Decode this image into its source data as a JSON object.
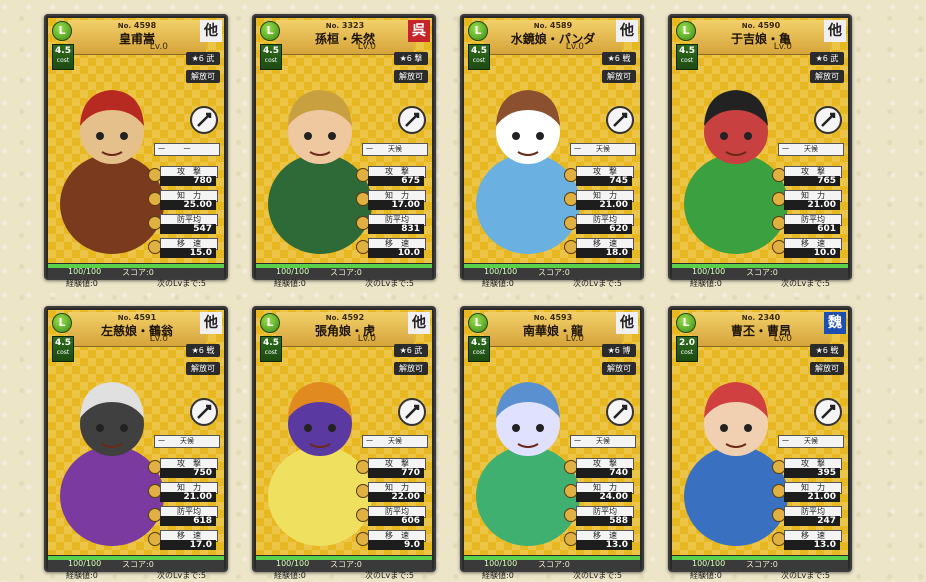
{
  "cards": [
    {
      "no": "4598",
      "name": "皇甫嵩",
      "lv": "Lv.0",
      "cost": "4.5",
      "faction": "他",
      "faction_color": "white",
      "rarity": "★6 武",
      "release": "解放可",
      "weapon": "sword-icon",
      "skill": "一",
      "stats": [
        {
          "label": "攻　撃",
          "value": "780"
        },
        {
          "label": "知　力",
          "value": "25.00"
        },
        {
          "label": "防平均",
          "value": "547"
        },
        {
          "label": "移　速",
          "value": "15.0"
        }
      ],
      "hp": "100/100",
      "hp_fraction": 1.0,
      "score": "スコア:0",
      "exp": "経験値:0",
      "next": "次のLvまで:5",
      "palette": [
        "#7a3a1e",
        "#b62a22",
        "#e6c08a"
      ]
    },
    {
      "no": "3323",
      "name": "孫桓・朱然",
      "lv": "Lv.0",
      "cost": "4.5",
      "faction": "呉",
      "faction_color": "red",
      "rarity": "★6 撃",
      "release": "解放可",
      "weapon": "axe-icon",
      "skill": "天候",
      "stats": [
        {
          "label": "攻　撃",
          "value": "675"
        },
        {
          "label": "知　力",
          "value": "17.00"
        },
        {
          "label": "防平均",
          "value": "831"
        },
        {
          "label": "移　速",
          "value": "10.0"
        }
      ],
      "hp": "100/100",
      "hp_fraction": 1.0,
      "score": "スコア:0",
      "exp": "経験値:0",
      "next": "次のLvまで:5",
      "palette": [
        "#2e6a38",
        "#c8a040",
        "#f0c8a0"
      ]
    },
    {
      "no": "4589",
      "name": "水鏡娘・パンダ",
      "lv": "Lv.0",
      "cost": "4.5",
      "faction": "他",
      "faction_color": "white",
      "rarity": "★6 戦",
      "release": "解放可",
      "weapon": "sword-icon",
      "skill": "天候",
      "stats": [
        {
          "label": "攻　撃",
          "value": "745"
        },
        {
          "label": "知　力",
          "value": "21.00"
        },
        {
          "label": "防平均",
          "value": "620"
        },
        {
          "label": "移　速",
          "value": "18.0"
        }
      ],
      "hp": "100/100",
      "hp_fraction": 1.0,
      "score": "スコア:0",
      "exp": "経験値:0",
      "next": "次のLvまで:5",
      "palette": [
        "#6ab0e0",
        "#8a5030",
        "#ffffff"
      ]
    },
    {
      "no": "4590",
      "name": "于吉娘・亀",
      "lv": "Lv.0",
      "cost": "4.5",
      "faction": "他",
      "faction_color": "white",
      "rarity": "★6 武",
      "release": "解放可",
      "weapon": "axe-icon",
      "skill": "天候",
      "stats": [
        {
          "label": "攻　撃",
          "value": "765"
        },
        {
          "label": "知　力",
          "value": "21.00"
        },
        {
          "label": "防平均",
          "value": "601"
        },
        {
          "label": "移　速",
          "value": "10.0"
        }
      ],
      "hp": "100/100",
      "hp_fraction": 1.0,
      "score": "スコア:0",
      "exp": "経験値:0",
      "next": "次のLvまで:5",
      "palette": [
        "#3aa040",
        "#222222",
        "#c84040"
      ]
    },
    {
      "no": "4591",
      "name": "左慈娘・鶴翁",
      "lv": "Lv.0",
      "cost": "4.5",
      "faction": "他",
      "faction_color": "white",
      "rarity": "★6 戦",
      "release": "解放可",
      "weapon": "sword-icon",
      "skill": "天候",
      "stats": [
        {
          "label": "攻　撃",
          "value": "750"
        },
        {
          "label": "知　力",
          "value": "21.00"
        },
        {
          "label": "防平均",
          "value": "618"
        },
        {
          "label": "移　速",
          "value": "17.0"
        }
      ],
      "hp": "100/100",
      "hp_fraction": 1.0,
      "score": "スコア:0",
      "exp": "経験値:0",
      "next": "次のLvまで:5",
      "palette": [
        "#7a3aa0",
        "#e0e0e0",
        "#404040"
      ]
    },
    {
      "no": "4592",
      "name": "張角娘・虎",
      "lv": "Lv.0",
      "cost": "4.5",
      "faction": "他",
      "faction_color": "white",
      "rarity": "★6 武",
      "release": "解放可",
      "weapon": "axe-icon",
      "skill": "天候",
      "stats": [
        {
          "label": "攻　撃",
          "value": "770"
        },
        {
          "label": "知　力",
          "value": "22.00"
        },
        {
          "label": "防平均",
          "value": "606"
        },
        {
          "label": "移　速",
          "value": "9.0"
        }
      ],
      "hp": "100/100",
      "hp_fraction": 1.0,
      "score": "スコア:0",
      "exp": "経験値:0",
      "next": "次のLvまで:5",
      "palette": [
        "#f0e060",
        "#e08a20",
        "#5a3aa0"
      ]
    },
    {
      "no": "4593",
      "name": "南華娘・龍",
      "lv": "Lv.0",
      "cost": "4.5",
      "faction": "他",
      "faction_color": "white",
      "rarity": "★6 博",
      "release": "解放可",
      "weapon": "spear-icon",
      "skill": "天候",
      "stats": [
        {
          "label": "攻　撃",
          "value": "740"
        },
        {
          "label": "知　力",
          "value": "24.00"
        },
        {
          "label": "防平均",
          "value": "588"
        },
        {
          "label": "移　速",
          "value": "13.0"
        }
      ],
      "hp": "100/100",
      "hp_fraction": 1.0,
      "score": "スコア:0",
      "exp": "経験値:0",
      "next": "次のLvまで:5",
      "palette": [
        "#40b070",
        "#5a90d0",
        "#e0e0ff"
      ]
    },
    {
      "no": "2340",
      "name": "曹丕・曹昂",
      "lv": "Lv.0",
      "cost": "2.0",
      "faction": "魏",
      "faction_color": "blue",
      "rarity": "★6 戦",
      "release": "解放可",
      "weapon": "spear-icon",
      "skill": "天候",
      "stats": [
        {
          "label": "攻　撃",
          "value": "395"
        },
        {
          "label": "知　力",
          "value": "21.00"
        },
        {
          "label": "防平均",
          "value": "247"
        },
        {
          "label": "移　速",
          "value": "13.0"
        }
      ],
      "hp": "100/100",
      "hp_fraction": 1.0,
      "score": "スコア:0",
      "exp": "経験値:0",
      "next": "次のLvまで:5",
      "palette": [
        "#3a70c0",
        "#d04040",
        "#f0d0b0"
      ]
    }
  ]
}
